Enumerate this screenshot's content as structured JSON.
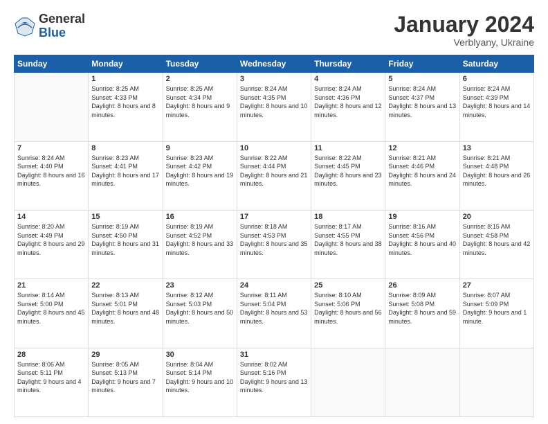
{
  "logo": {
    "general": "General",
    "blue": "Blue"
  },
  "title": "January 2024",
  "location": "Verblyany, Ukraine",
  "days_header": [
    "Sunday",
    "Monday",
    "Tuesday",
    "Wednesday",
    "Thursday",
    "Friday",
    "Saturday"
  ],
  "weeks": [
    [
      {
        "day": "",
        "sunrise": "",
        "sunset": "",
        "daylight": ""
      },
      {
        "day": "1",
        "sunrise": "Sunrise: 8:25 AM",
        "sunset": "Sunset: 4:33 PM",
        "daylight": "Daylight: 8 hours and 8 minutes."
      },
      {
        "day": "2",
        "sunrise": "Sunrise: 8:25 AM",
        "sunset": "Sunset: 4:34 PM",
        "daylight": "Daylight: 8 hours and 9 minutes."
      },
      {
        "day": "3",
        "sunrise": "Sunrise: 8:24 AM",
        "sunset": "Sunset: 4:35 PM",
        "daylight": "Daylight: 8 hours and 10 minutes."
      },
      {
        "day": "4",
        "sunrise": "Sunrise: 8:24 AM",
        "sunset": "Sunset: 4:36 PM",
        "daylight": "Daylight: 8 hours and 12 minutes."
      },
      {
        "day": "5",
        "sunrise": "Sunrise: 8:24 AM",
        "sunset": "Sunset: 4:37 PM",
        "daylight": "Daylight: 8 hours and 13 minutes."
      },
      {
        "day": "6",
        "sunrise": "Sunrise: 8:24 AM",
        "sunset": "Sunset: 4:39 PM",
        "daylight": "Daylight: 8 hours and 14 minutes."
      }
    ],
    [
      {
        "day": "7",
        "sunrise": "Sunrise: 8:24 AM",
        "sunset": "Sunset: 4:40 PM",
        "daylight": "Daylight: 8 hours and 16 minutes."
      },
      {
        "day": "8",
        "sunrise": "Sunrise: 8:23 AM",
        "sunset": "Sunset: 4:41 PM",
        "daylight": "Daylight: 8 hours and 17 minutes."
      },
      {
        "day": "9",
        "sunrise": "Sunrise: 8:23 AM",
        "sunset": "Sunset: 4:42 PM",
        "daylight": "Daylight: 8 hours and 19 minutes."
      },
      {
        "day": "10",
        "sunrise": "Sunrise: 8:22 AM",
        "sunset": "Sunset: 4:44 PM",
        "daylight": "Daylight: 8 hours and 21 minutes."
      },
      {
        "day": "11",
        "sunrise": "Sunrise: 8:22 AM",
        "sunset": "Sunset: 4:45 PM",
        "daylight": "Daylight: 8 hours and 23 minutes."
      },
      {
        "day": "12",
        "sunrise": "Sunrise: 8:21 AM",
        "sunset": "Sunset: 4:46 PM",
        "daylight": "Daylight: 8 hours and 24 minutes."
      },
      {
        "day": "13",
        "sunrise": "Sunrise: 8:21 AM",
        "sunset": "Sunset: 4:48 PM",
        "daylight": "Daylight: 8 hours and 26 minutes."
      }
    ],
    [
      {
        "day": "14",
        "sunrise": "Sunrise: 8:20 AM",
        "sunset": "Sunset: 4:49 PM",
        "daylight": "Daylight: 8 hours and 29 minutes."
      },
      {
        "day": "15",
        "sunrise": "Sunrise: 8:19 AM",
        "sunset": "Sunset: 4:50 PM",
        "daylight": "Daylight: 8 hours and 31 minutes."
      },
      {
        "day": "16",
        "sunrise": "Sunrise: 8:19 AM",
        "sunset": "Sunset: 4:52 PM",
        "daylight": "Daylight: 8 hours and 33 minutes."
      },
      {
        "day": "17",
        "sunrise": "Sunrise: 8:18 AM",
        "sunset": "Sunset: 4:53 PM",
        "daylight": "Daylight: 8 hours and 35 minutes."
      },
      {
        "day": "18",
        "sunrise": "Sunrise: 8:17 AM",
        "sunset": "Sunset: 4:55 PM",
        "daylight": "Daylight: 8 hours and 38 minutes."
      },
      {
        "day": "19",
        "sunrise": "Sunrise: 8:16 AM",
        "sunset": "Sunset: 4:56 PM",
        "daylight": "Daylight: 8 hours and 40 minutes."
      },
      {
        "day": "20",
        "sunrise": "Sunrise: 8:15 AM",
        "sunset": "Sunset: 4:58 PM",
        "daylight": "Daylight: 8 hours and 42 minutes."
      }
    ],
    [
      {
        "day": "21",
        "sunrise": "Sunrise: 8:14 AM",
        "sunset": "Sunset: 5:00 PM",
        "daylight": "Daylight: 8 hours and 45 minutes."
      },
      {
        "day": "22",
        "sunrise": "Sunrise: 8:13 AM",
        "sunset": "Sunset: 5:01 PM",
        "daylight": "Daylight: 8 hours and 48 minutes."
      },
      {
        "day": "23",
        "sunrise": "Sunrise: 8:12 AM",
        "sunset": "Sunset: 5:03 PM",
        "daylight": "Daylight: 8 hours and 50 minutes."
      },
      {
        "day": "24",
        "sunrise": "Sunrise: 8:11 AM",
        "sunset": "Sunset: 5:04 PM",
        "daylight": "Daylight: 8 hours and 53 minutes."
      },
      {
        "day": "25",
        "sunrise": "Sunrise: 8:10 AM",
        "sunset": "Sunset: 5:06 PM",
        "daylight": "Daylight: 8 hours and 56 minutes."
      },
      {
        "day": "26",
        "sunrise": "Sunrise: 8:09 AM",
        "sunset": "Sunset: 5:08 PM",
        "daylight": "Daylight: 8 hours and 59 minutes."
      },
      {
        "day": "27",
        "sunrise": "Sunrise: 8:07 AM",
        "sunset": "Sunset: 5:09 PM",
        "daylight": "Daylight: 9 hours and 1 minute."
      }
    ],
    [
      {
        "day": "28",
        "sunrise": "Sunrise: 8:06 AM",
        "sunset": "Sunset: 5:11 PM",
        "daylight": "Daylight: 9 hours and 4 minutes."
      },
      {
        "day": "29",
        "sunrise": "Sunrise: 8:05 AM",
        "sunset": "Sunset: 5:13 PM",
        "daylight": "Daylight: 9 hours and 7 minutes."
      },
      {
        "day": "30",
        "sunrise": "Sunrise: 8:04 AM",
        "sunset": "Sunset: 5:14 PM",
        "daylight": "Daylight: 9 hours and 10 minutes."
      },
      {
        "day": "31",
        "sunrise": "Sunrise: 8:02 AM",
        "sunset": "Sunset: 5:16 PM",
        "daylight": "Daylight: 9 hours and 13 minutes."
      },
      {
        "day": "",
        "sunrise": "",
        "sunset": "",
        "daylight": ""
      },
      {
        "day": "",
        "sunrise": "",
        "sunset": "",
        "daylight": ""
      },
      {
        "day": "",
        "sunrise": "",
        "sunset": "",
        "daylight": ""
      }
    ]
  ]
}
